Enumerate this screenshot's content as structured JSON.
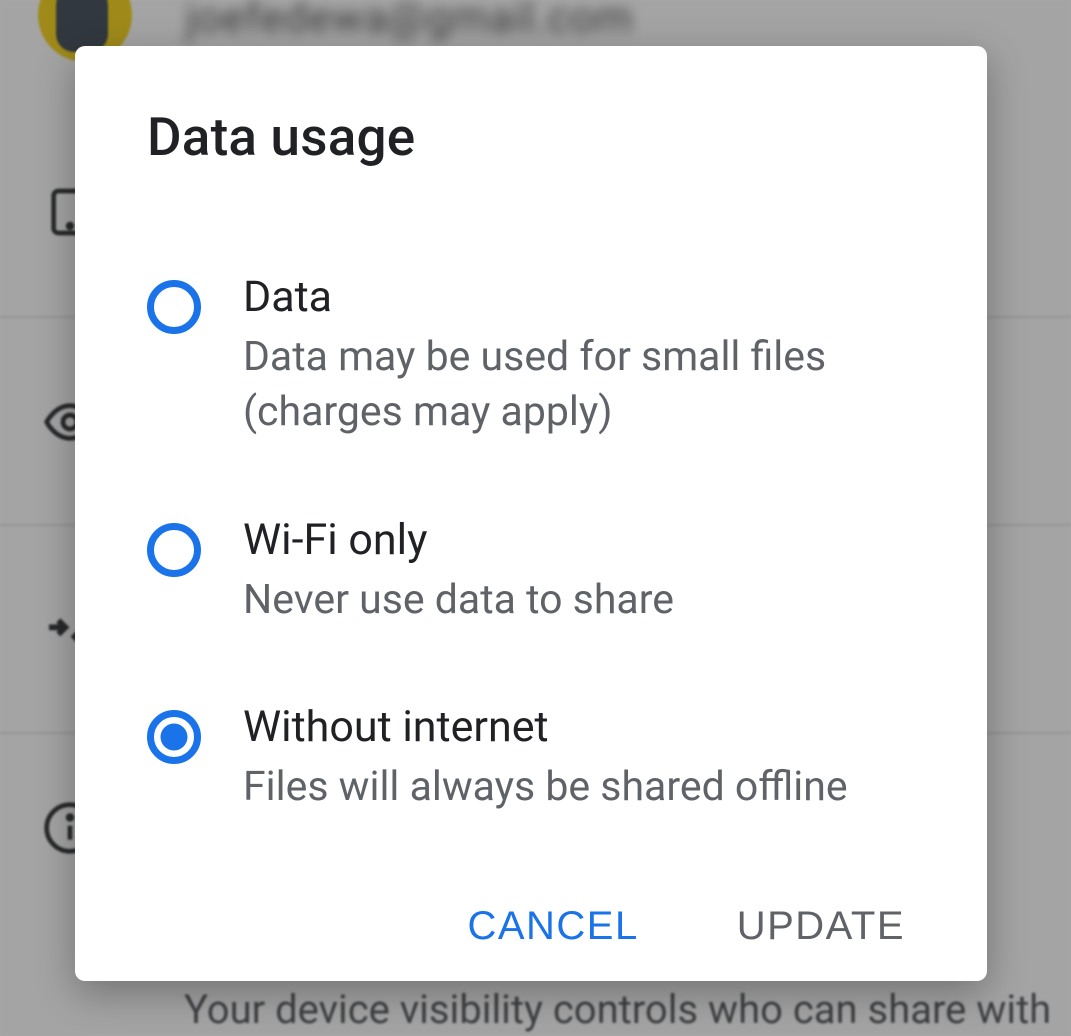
{
  "background": {
    "email": "joefedewa@gmail.com",
    "hint": "Your device visibility controls who can share with"
  },
  "dialog": {
    "title": "Data usage",
    "options": [
      {
        "title": "Data",
        "subtitle": "Data may be used for small files (charges may apply)",
        "checked": false
      },
      {
        "title": "Wi-Fi only",
        "subtitle": "Never use data to share",
        "checked": false
      },
      {
        "title": "Without internet",
        "subtitle": "Files will always be shared offline",
        "checked": true
      }
    ],
    "actions": {
      "cancel": "CANCEL",
      "update": "UPDATE"
    }
  }
}
